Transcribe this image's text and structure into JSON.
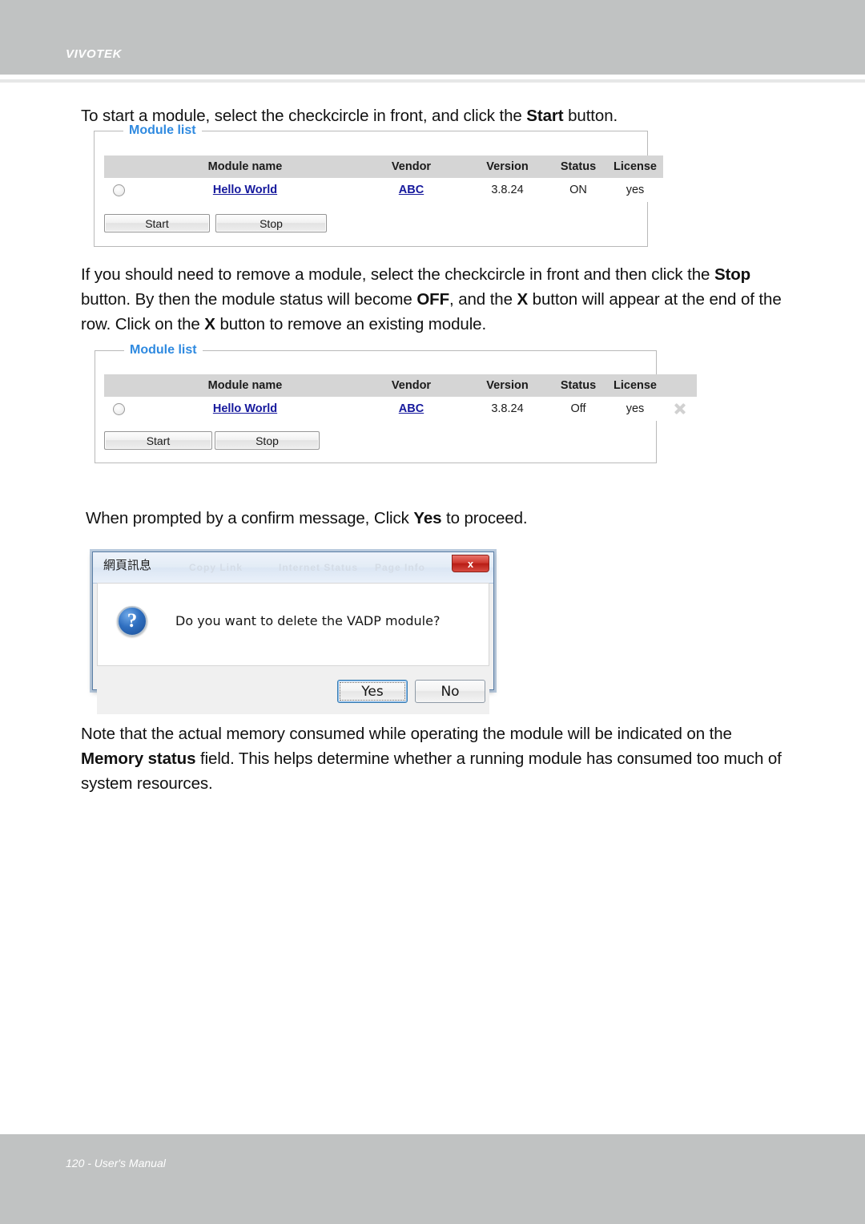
{
  "header": {
    "brand": "VIVOTEK"
  },
  "footer": {
    "page_label": "120 - User's Manual"
  },
  "paragraphs": {
    "p1_a": "To start a module, select the checkcircle in front, and click the ",
    "p1_b": "Start",
    "p1_c": " button.",
    "p2_a": "If you should need to remove a module, select the checkcircle in front and then click the ",
    "p2_b": "Stop",
    "p2_c": " button. By then the module status will become ",
    "p2_d": "OFF",
    "p2_e": ", and the ",
    "p2_f": "X",
    "p2_g": " button will appear at the end of the row. Click on the ",
    "p2_h": "X",
    "p2_i": " button to remove an existing module.",
    "p3_a": "When prompted by a confirm message, Click ",
    "p3_b": "Yes",
    "p3_c": " to proceed.",
    "p4_a": "Note that the actual memory consumed while operating the module will be indicated on the ",
    "p4_b": "Memory status",
    "p4_c": " field. This helps determine whether a running module has consumed too much of system resources."
  },
  "module_panel_1": {
    "legend": "Module list",
    "columns": [
      "",
      "Module name",
      "Vendor",
      "Version",
      "Status",
      "License"
    ],
    "rows": [
      {
        "selected": false,
        "module_name": "Hello World",
        "vendor": "ABC",
        "version": "3.8.24",
        "status": "ON",
        "license": "yes"
      }
    ],
    "buttons": {
      "start": "Start",
      "stop": "Stop"
    }
  },
  "module_panel_2": {
    "legend": "Module list",
    "columns": [
      "",
      "Module name",
      "Vendor",
      "Version",
      "Status",
      "License",
      ""
    ],
    "rows": [
      {
        "selected": false,
        "module_name": "Hello World",
        "vendor": "ABC",
        "version": "3.8.24",
        "status": "Off",
        "license": "yes",
        "delete_icon": "delete-x-icon"
      }
    ],
    "buttons": {
      "start": "Start",
      "stop": "Stop"
    }
  },
  "dialog": {
    "title": "網頁訊息",
    "close_label": "x",
    "icon": "question-icon",
    "icon_glyph": "?",
    "message": "Do you want to delete the VADP module?",
    "buttons": {
      "yes": "Yes",
      "no": "No"
    },
    "ghost_text_1": "Copy Link",
    "ghost_text_2": "Internet Status",
    "ghost_text_3": "Page Info"
  },
  "colors": {
    "header_bar": "#c0c2c2",
    "legend_blue": "#2f8ae0",
    "link_blue": "#15189c",
    "table_header": "#d5d5d5"
  }
}
